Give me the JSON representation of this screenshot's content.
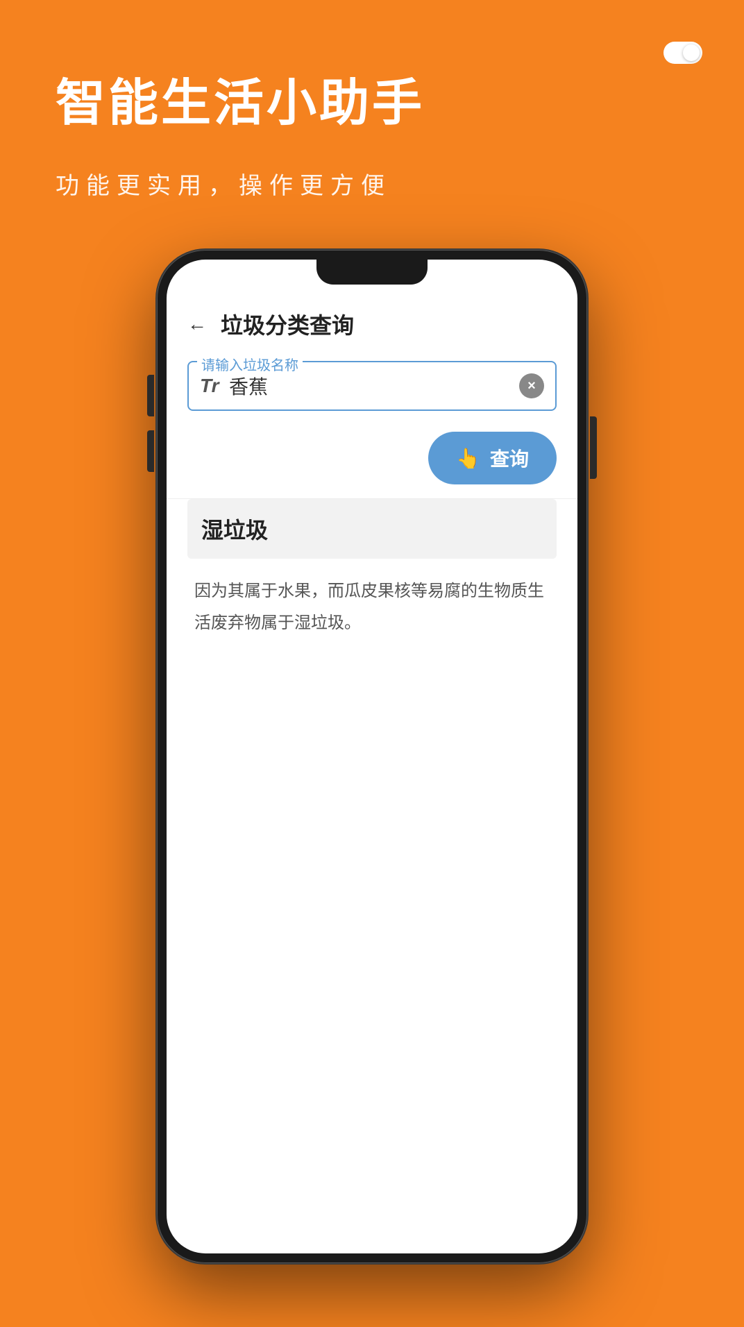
{
  "background_color": "#F5821F",
  "toggle": {
    "visible": true
  },
  "hero": {
    "title": "智能生活小助手",
    "subtitle": "功能更实用，操作更方便"
  },
  "app": {
    "header": {
      "back_label": "←",
      "title": "垃圾分类查询"
    },
    "search": {
      "floating_label": "请输入垃圾名称",
      "font_icon": "Tr",
      "input_value": "香蕉",
      "input_placeholder": "请输入垃圾名称",
      "clear_icon": "×"
    },
    "query_button": {
      "icon": "👆",
      "label": "查询"
    },
    "result": {
      "category": "湿垃圾",
      "description": "因为其属于水果，而瓜皮果核等易腐的生物质生活废弃物属于湿垃圾。"
    }
  }
}
